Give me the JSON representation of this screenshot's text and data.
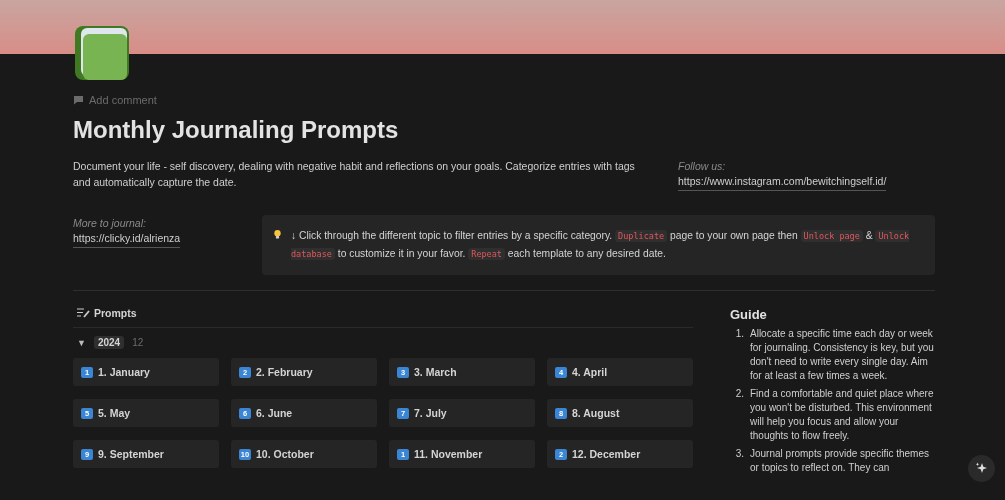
{
  "comment_action": "Add comment",
  "title": "Monthly Journaling Prompts",
  "description": "Document your life - self discovery, dealing with negative habit and reflections on your goals. Categorize entries with tags and automatically capture the date.",
  "follow": {
    "label": "Follow us:",
    "link": "https://www.instagram.com/bewitchingself.id/"
  },
  "more": {
    "label": "More to journal:",
    "link": "https://clicky.id/alrienza"
  },
  "callout": [
    {
      "kind": "text",
      "text": "↓ Click through the different topic to filter entries by a specific category. "
    },
    {
      "kind": "code",
      "text": "Duplicate"
    },
    {
      "kind": "text",
      "text": " page to your own page then "
    },
    {
      "kind": "code",
      "text": "Unlock page"
    },
    {
      "kind": "text",
      "text": " & "
    },
    {
      "kind": "code",
      "text": "Unlock database"
    },
    {
      "kind": "text",
      "text": " to customize it in your favor. "
    },
    {
      "kind": "code",
      "text": "Repeat"
    },
    {
      "kind": "text",
      "text": " each template to any desired date."
    }
  ],
  "database": {
    "title": "Prompts",
    "group": {
      "label": "2024",
      "toggle": "▼",
      "count": "12",
      "expanded": true
    },
    "cards": [
      {
        "badge": "1",
        "title": "1. January"
      },
      {
        "badge": "2",
        "title": "2. February"
      },
      {
        "badge": "3",
        "title": "3. March"
      },
      {
        "badge": "4",
        "title": "4. April"
      },
      {
        "badge": "5",
        "title": "5. May"
      },
      {
        "badge": "6",
        "title": "6. June"
      },
      {
        "badge": "7",
        "title": "7. July"
      },
      {
        "badge": "8",
        "title": "8. August"
      },
      {
        "badge": "9",
        "title": "9. September"
      },
      {
        "badge": "10",
        "title": "10. October"
      },
      {
        "badge": "1",
        "title": "11. November"
      },
      {
        "badge": "2",
        "title": "12. December"
      }
    ]
  },
  "guide": {
    "title": "Guide",
    "items": [
      {
        "number": "1.",
        "text": "Allocate a specific time each day or week for journaling. Consistency is key, but you don't need to write every single day. Aim for at least a few times a week."
      },
      {
        "number": "2.",
        "text": "Find a comfortable and quiet place where you won't be disturbed. This environment will help you focus and allow your thoughts to flow freely."
      },
      {
        "number": "3.",
        "text": "Journal prompts provide specific themes or topics to reflect on. They can"
      }
    ]
  }
}
